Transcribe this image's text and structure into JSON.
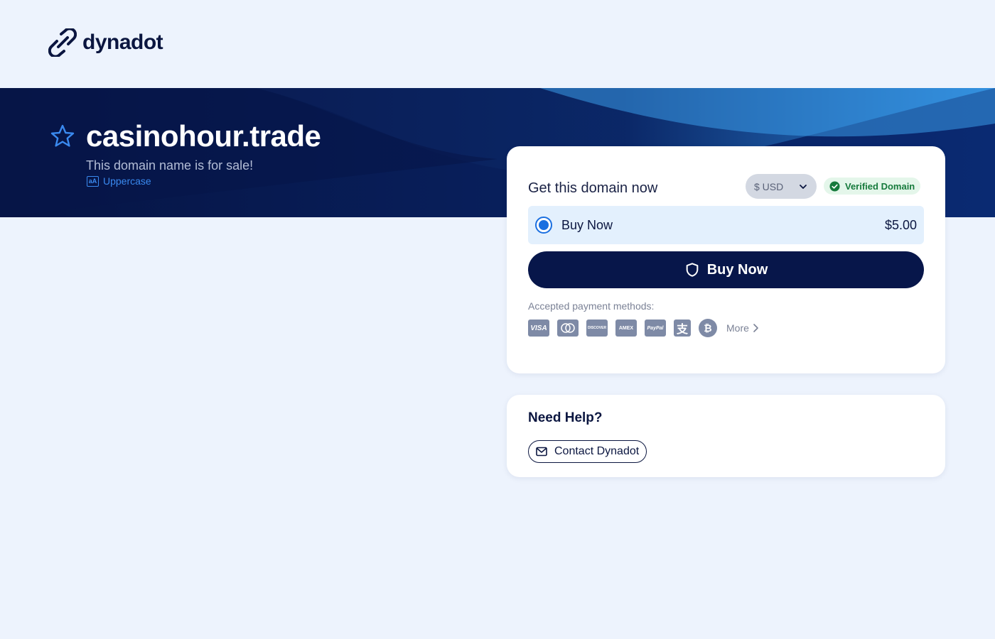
{
  "header": {
    "brand": "dynadot"
  },
  "hero": {
    "domain": "casinohour.trade",
    "subtitle": "This domain name is for sale!",
    "uppercase_label": "Uppercase",
    "uppercase_icon_text": "aA"
  },
  "purchase": {
    "heading": "Get this domain now",
    "currency": "$ USD",
    "verified_label": "Verified Domain",
    "option_label": "Buy Now",
    "option_price": "$5.00",
    "option_selected": true,
    "buy_button_label": "Buy Now",
    "payment_label": "Accepted payment methods:",
    "payment_methods": [
      {
        "name": "visa-icon",
        "text": "VISA"
      },
      {
        "name": "mastercard-icon",
        "text": ""
      },
      {
        "name": "discover-icon",
        "text": "DISCOVER"
      },
      {
        "name": "amex-icon",
        "text": "AMEX"
      },
      {
        "name": "paypal-icon",
        "text": "PayPal"
      },
      {
        "name": "alipay-icon",
        "text": "支"
      },
      {
        "name": "bitcoin-icon",
        "text": "₿"
      }
    ],
    "more_label": "More"
  },
  "help": {
    "title": "Need Help?",
    "contact_label": "Contact Dynadot"
  },
  "colors": {
    "navy": "#07164a",
    "accent_blue": "#1a6fe0",
    "verified_green": "#167a3c",
    "page_bg": "#edf3fd"
  }
}
